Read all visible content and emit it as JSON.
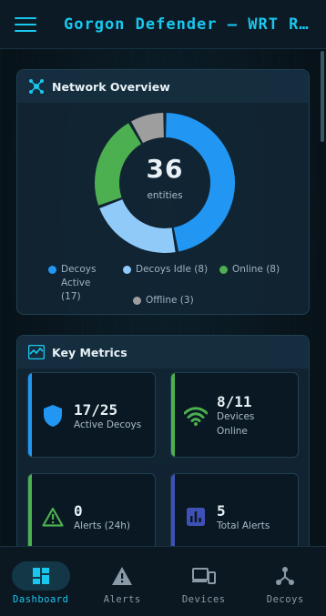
{
  "app": {
    "title": "Gorgon Defender — WRT Ro..."
  },
  "network_overview": {
    "title": "Network Overview",
    "total": "36",
    "total_label": "entities",
    "segments": [
      {
        "label": "Decoys Active (17)",
        "value": 17,
        "color": "#2196f3"
      },
      {
        "label": "Decoys Idle (8)",
        "value": 8,
        "color": "#90caf9"
      },
      {
        "label": "Online (8)",
        "value": 8,
        "color": "#4caf50"
      },
      {
        "label": "Offline (3)",
        "value": 3,
        "color": "#9e9e9e"
      }
    ]
  },
  "key_metrics": {
    "title": "Key Metrics",
    "tiles": [
      {
        "value": "17/25",
        "label": "Active Decoys",
        "color": "#2196f3",
        "icon": "shield-icon"
      },
      {
        "value": "8/11",
        "label": "Devices Online",
        "color": "#4caf50",
        "icon": "wifi-icon"
      },
      {
        "value": "0",
        "label": "Alerts (24h)",
        "color": "#4caf50",
        "icon": "warning-icon"
      },
      {
        "value": "5",
        "label": "Total Alerts",
        "color": "#3f51b5",
        "icon": "bar-chart-icon"
      }
    ]
  },
  "nav": [
    {
      "label": "Dashboard",
      "icon": "dashboard-icon",
      "active": true
    },
    {
      "label": "Alerts",
      "icon": "warning-icon",
      "active": false
    },
    {
      "label": "Devices",
      "icon": "devices-icon",
      "active": false
    },
    {
      "label": "Decoys",
      "icon": "hub-icon",
      "active": false
    }
  ],
  "colors": {
    "accent": "#19c7ee",
    "background": "#081219"
  }
}
